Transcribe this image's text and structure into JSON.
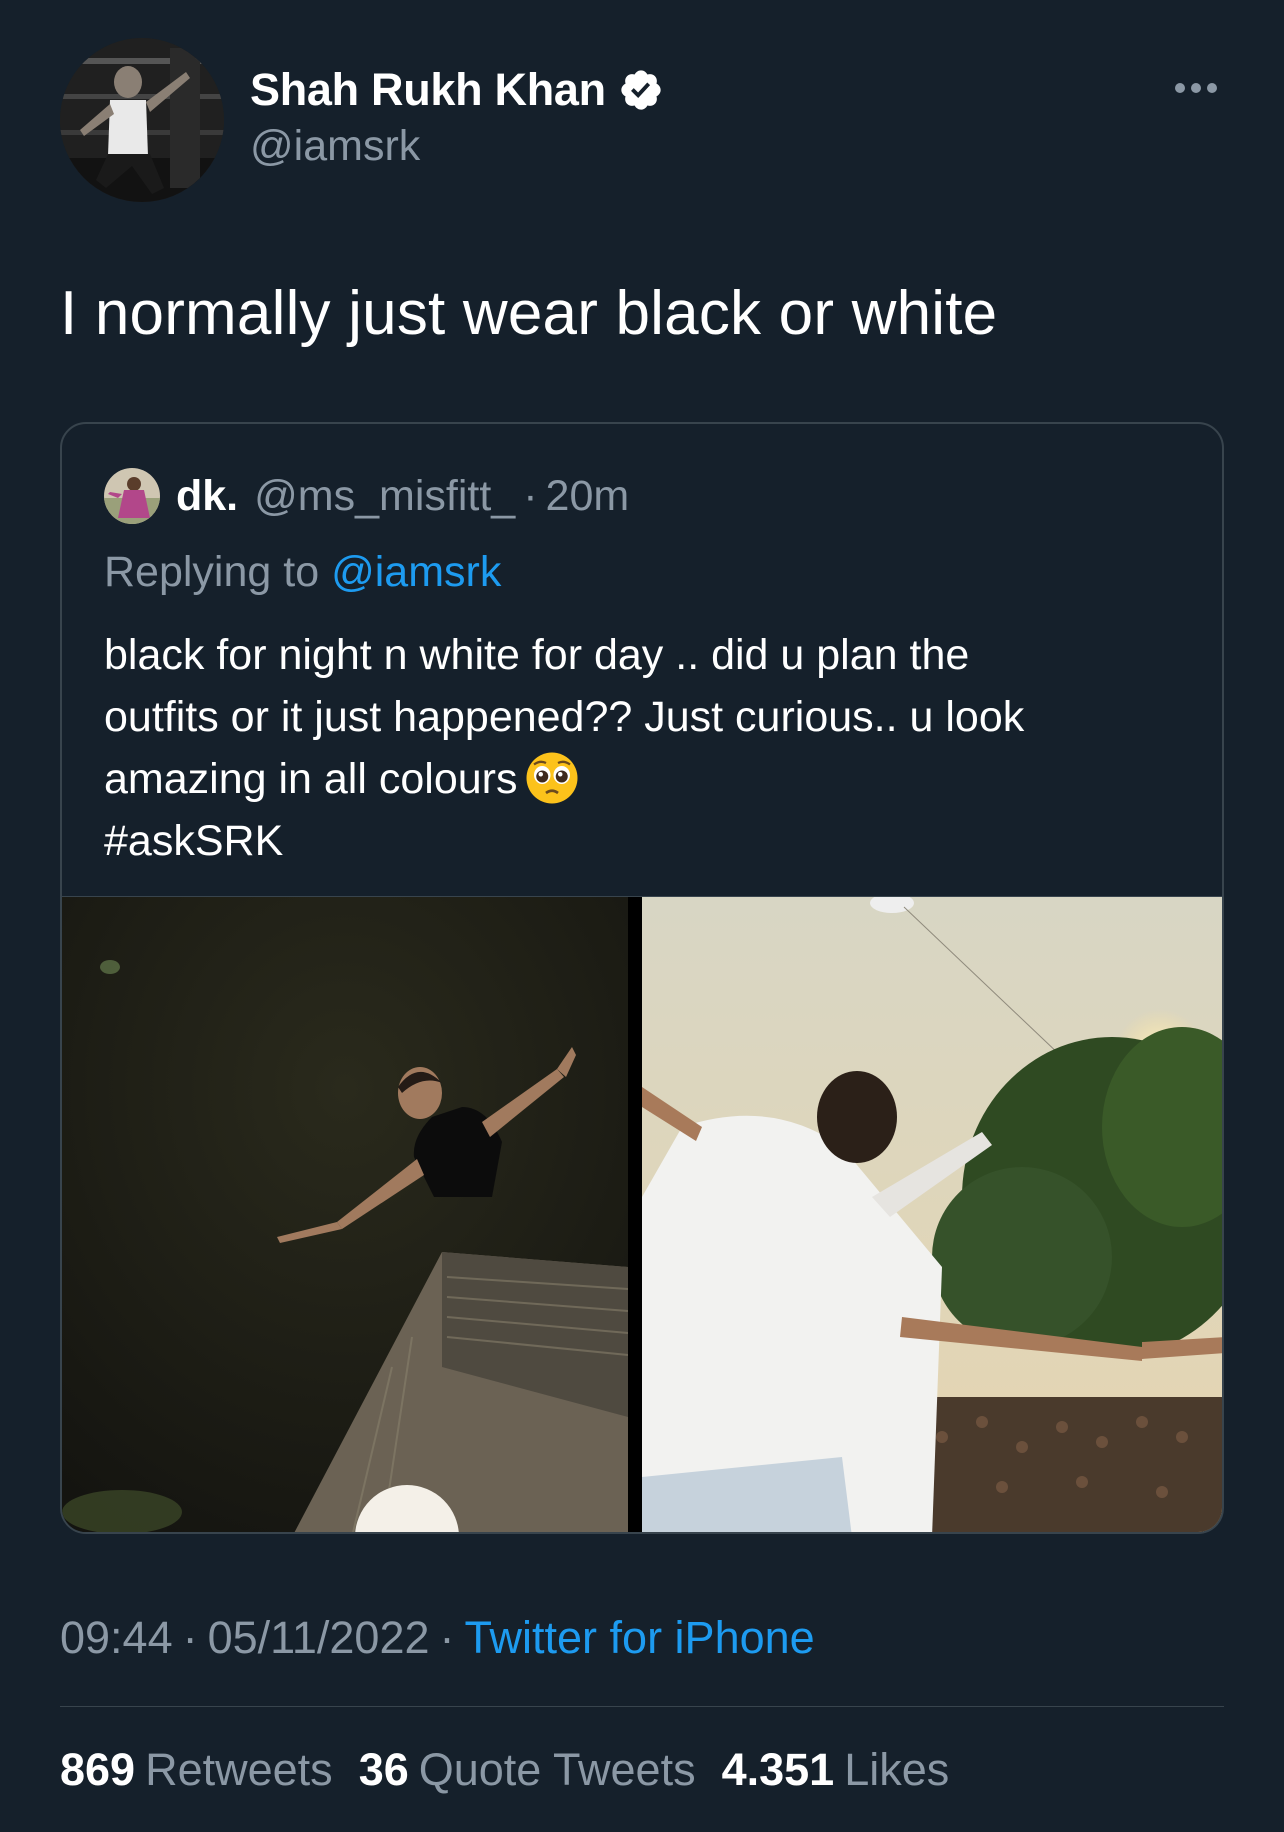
{
  "tweet": {
    "author": {
      "name": "Shah Rukh Khan",
      "handle": "@iamsrk",
      "verified": true
    },
    "text": "I normally just wear black or white",
    "more_icon": "more-horizontal-icon"
  },
  "quoted": {
    "name": "dk.",
    "handle": "@ms_misfitt_",
    "separator": "·",
    "time": "20m",
    "replying_prefix": "Replying to",
    "replying_to": "@iamsrk",
    "lines": [
      "black for night n white for day .. did u plan the",
      "outfits or it just happened?? Just curious.. u look",
      "amazing in all colours"
    ],
    "emoji": "pleading-face-emoji",
    "hashtag": "#askSRK"
  },
  "meta": {
    "time": "09:44",
    "separator": "·",
    "date": "05/11/2022",
    "source": "Twitter for iPhone"
  },
  "stats": {
    "retweets": {
      "count": "869",
      "label": "Retweets"
    },
    "quotes": {
      "count": "36",
      "label": "Quote Tweets"
    },
    "likes": {
      "count": "4.351",
      "label": "Likes"
    }
  },
  "colors": {
    "background": "#15202b",
    "muted": "#8b98a5",
    "accent": "#1d9bf0",
    "border": "#38444d"
  }
}
